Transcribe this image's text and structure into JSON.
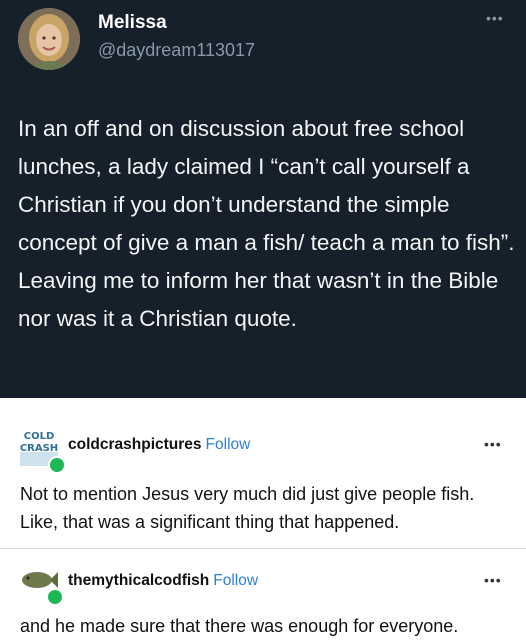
{
  "tweet": {
    "name": "Melissa",
    "handle": "@daydream113017",
    "more_icon": "ellipsis-icon",
    "text": "In an off and on discussion about free school lunches, a lady claimed I “can’t call yourself a Christian if you don’t understand the simple concept of give a man a fish/ teach a man to fish”. Leaving me to inform her that wasn’t in the Bible nor was it a Christian quote."
  },
  "reblogs": [
    {
      "username": "coldcrashpictures",
      "avatar_text_line1": "COLD",
      "avatar_text_line2": "CRASH",
      "follow_label": "Follow",
      "text": "Not to mention Jesus very much did just give people fish. Like, that was a significant thing that happened."
    },
    {
      "username": "themythicalcodfish",
      "follow_label": "Follow",
      "text": "and he made sure that there was enough for everyone."
    }
  ],
  "colors": {
    "tweet_bg": "#15202b",
    "follow": "#2e7fd8",
    "reblog_badge": "#1db954"
  }
}
